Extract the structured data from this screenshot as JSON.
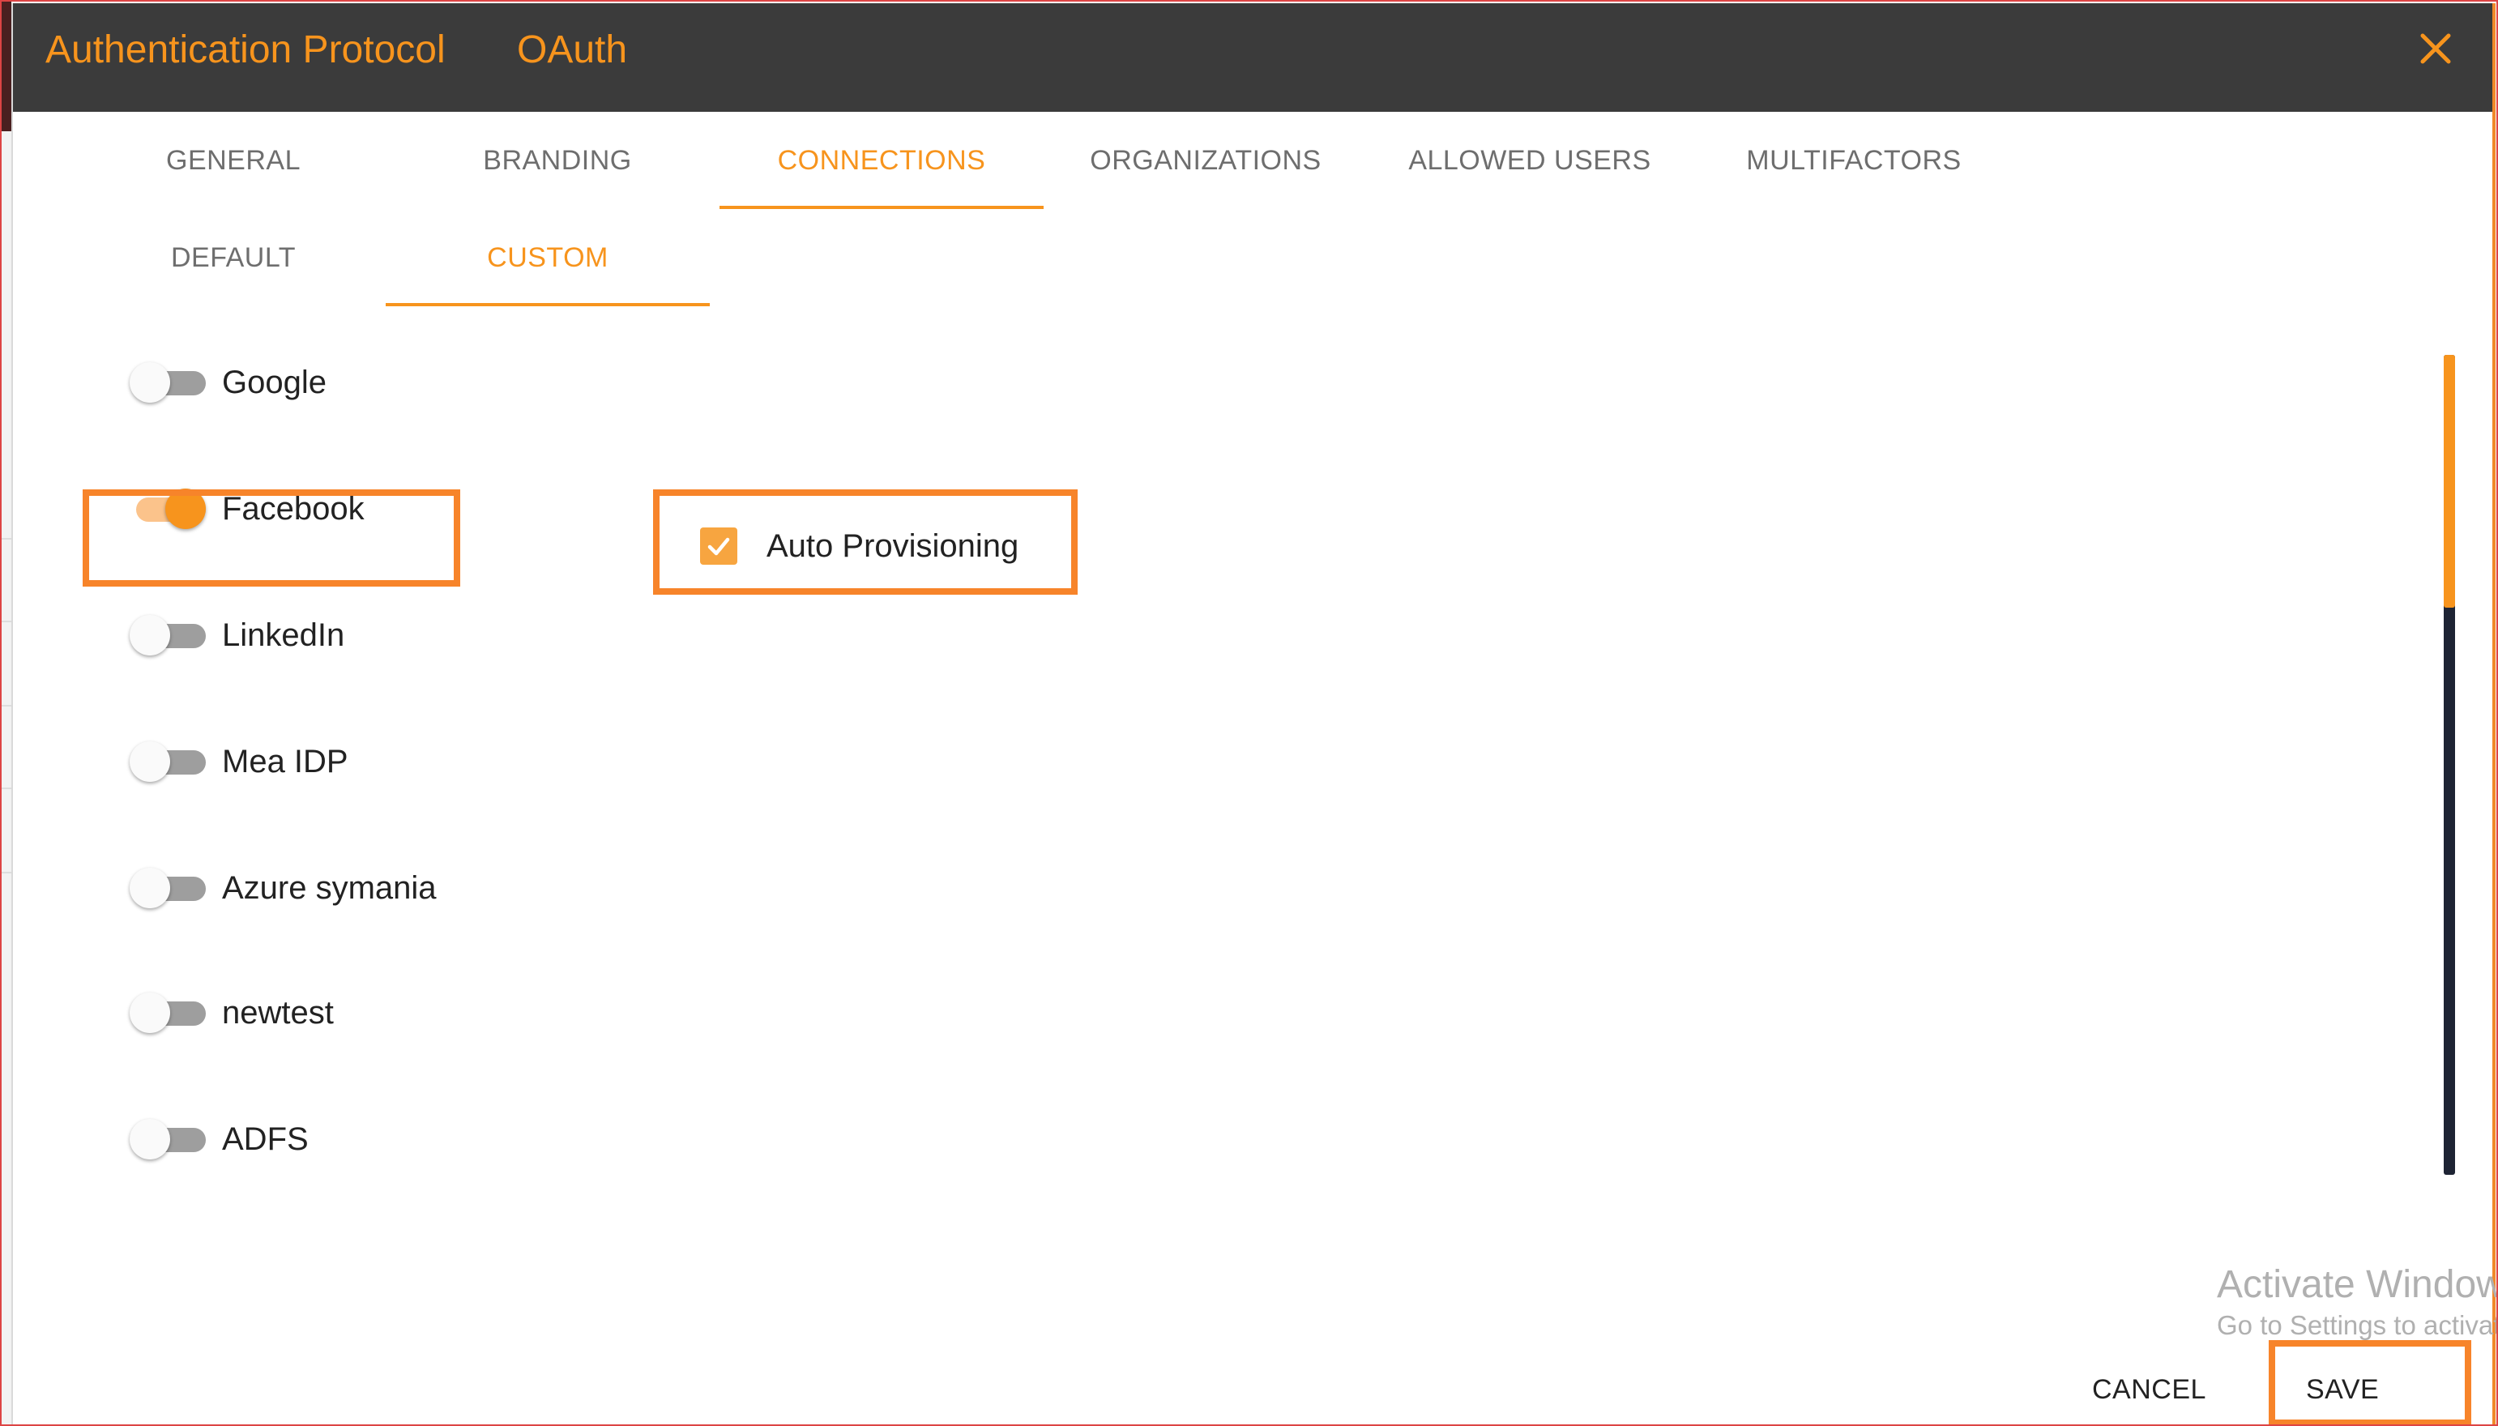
{
  "dialog": {
    "title_label": "Authentication Protocol",
    "title_value": "OAuth",
    "close_icon": "close-icon"
  },
  "tabs": [
    {
      "label": "GENERAL",
      "active": false
    },
    {
      "label": "BRANDING",
      "active": false
    },
    {
      "label": "CONNECTIONS",
      "active": true
    },
    {
      "label": "ORGANIZATIONS",
      "active": false
    },
    {
      "label": "ALLOWED USERS",
      "active": false
    },
    {
      "label": "MULTIFACTORS",
      "active": false
    }
  ],
  "subtabs": [
    {
      "label": "DEFAULT",
      "active": false
    },
    {
      "label": "CUSTOM",
      "active": true
    }
  ],
  "connections": [
    {
      "label": "Google",
      "enabled": false
    },
    {
      "label": "Facebook",
      "enabled": true
    },
    {
      "label": "LinkedIn",
      "enabled": false
    },
    {
      "label": "Mea IDP",
      "enabled": false
    },
    {
      "label": "Azure symania",
      "enabled": false
    },
    {
      "label": "newtest",
      "enabled": false
    },
    {
      "label": "ADFS",
      "enabled": false
    }
  ],
  "auto_provisioning": {
    "label": "Auto Provisioning",
    "checked": true
  },
  "footer": {
    "cancel_label": "CANCEL",
    "save_label": "SAVE"
  },
  "watermark": {
    "line1": "Activate Windows",
    "line2": "Go to Settings to activate Windows."
  },
  "colors": {
    "accent": "#f7941d",
    "highlight": "#f7842a",
    "titlebar": "#3b3b3b",
    "scroll_track": "#1e2434"
  }
}
